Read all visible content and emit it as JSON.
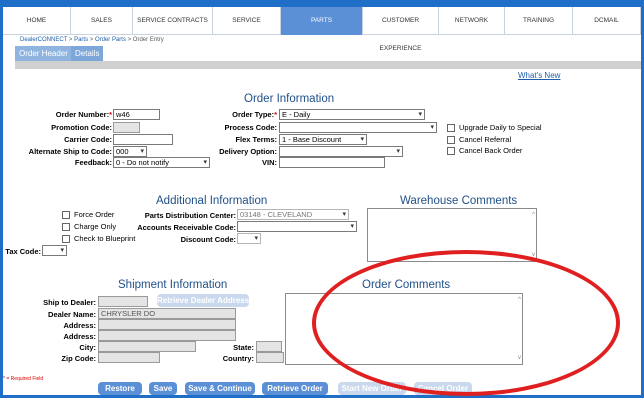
{
  "nav": {
    "items": [
      "HOME",
      "SALES",
      "SERVICE CONTRACTS",
      "SERVICE",
      "PARTS",
      "CUSTOMER EXPERIENCE",
      "NETWORK",
      "TRAINING",
      "DCMAIL"
    ],
    "active": "PARTS",
    "active_color": "#5b8fd6"
  },
  "breadcrumb": {
    "part1": "DealerCONNECT",
    "sep": " > ",
    "part2": "Parts",
    "part3": "Order Parts",
    "part4": "Order Entry"
  },
  "tabs": {
    "order_header": "Order Header",
    "details": "Details"
  },
  "whats_new": "What's New",
  "order_info": {
    "heading": "Order Information",
    "order_number_label": "Order Number:",
    "order_number_req": "*",
    "order_number_value": "w46",
    "promotion_code_label": "Promotion Code:",
    "carrier_code_label": "Carrier Code:",
    "alt_ship_label": "Alternate Ship to Code:",
    "alt_ship_value": "000",
    "feedback_label": "Feedback:",
    "feedback_value": "0 - Do not notify",
    "order_type_label": "Order Type:",
    "order_type_req": "*",
    "order_type_value": "E - Daily",
    "process_code_label": "Process Code:",
    "flex_terms_label": "Flex Terms:",
    "flex_terms_value": "1 - Base Discount",
    "delivery_option_label": "Delivery Option:",
    "vin_label": "VIN:",
    "upgrade_label": "Upgrade Daily to Special",
    "cancel_referral_label": "Cancel Referral",
    "cancel_backorder_label": "Cancel Back Order"
  },
  "additional": {
    "heading": "Additional Information",
    "force_order": "Force Order",
    "charge_only": "Charge Only",
    "check_blueprint": "Check to Blueprint",
    "tax_code_label": "Tax Code:",
    "pdc_label": "Parts Distribution Center:",
    "pdc_value": "03148 - CLEVELAND",
    "ar_code_label": "Accounts Receivable Code:",
    "discount_code_label": "Discount Code:"
  },
  "warehouse": {
    "heading": "Warehouse Comments"
  },
  "shipment": {
    "heading": "Shipment Information",
    "ship_to_label": "Ship to Dealer:",
    "retrieve_address": "Retrieve Dealer Address",
    "dealer_name_label": "Dealer Name:",
    "dealer_name_value": "CHRYSLER DO",
    "address1_label": "Address:",
    "address2_label": "Address:",
    "city_label": "City:",
    "state_label": "State:",
    "zip_label": "Zip Code:",
    "country_label": "Country:"
  },
  "order_comments": {
    "heading": "Order Comments"
  },
  "required_note": "* = Required Field",
  "buttons": {
    "restore": "Restore",
    "save": "Save",
    "save_continue": "Save & Continue",
    "retrieve": "Retrieve Order",
    "start_new": "Start New Order",
    "cancel_order": "Cancel Order"
  },
  "annotation_color": "#e02020"
}
